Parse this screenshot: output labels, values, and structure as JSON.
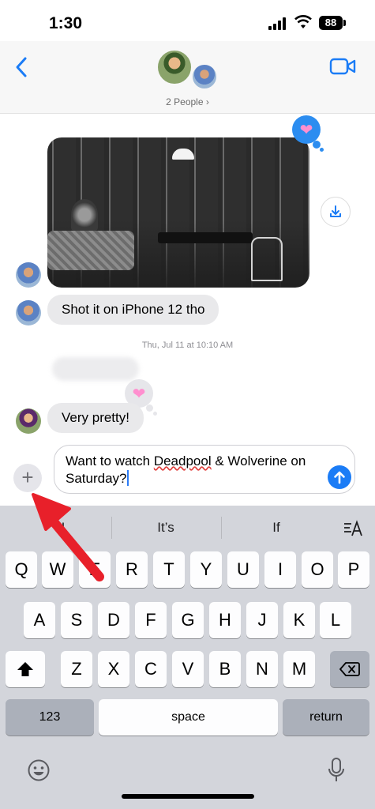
{
  "status_bar": {
    "time": "1:30",
    "battery": "88"
  },
  "header": {
    "people_label": "2 People ›"
  },
  "chat": {
    "message_1": "Shot it on iPhone 12 tho",
    "timestamp": "Thu, Jul 11 at 10:10 AM",
    "message_2": "Very pretty!"
  },
  "composer": {
    "text_part1": "Want to watch ",
    "text_typo": "Deadpool",
    "text_part2": " & Wolverine on Saturday?"
  },
  "keyboard": {
    "suggestions": [
      "I",
      "It’s",
      "If"
    ],
    "row1": [
      "Q",
      "W",
      "E",
      "R",
      "T",
      "Y",
      "U",
      "I",
      "O",
      "P"
    ],
    "row2": [
      "A",
      "S",
      "D",
      "F",
      "G",
      "H",
      "J",
      "K",
      "L"
    ],
    "row3": [
      "Z",
      "X",
      "C",
      "V",
      "B",
      "N",
      "M"
    ],
    "numbers_label": "123",
    "space_label": "space",
    "return_label": "return"
  },
  "colors": {
    "accent": "#1b7cf6",
    "annotation_arrow": "#e8202a"
  },
  "icons": [
    "back-icon",
    "video-call-icon",
    "heart-icon",
    "download-icon",
    "plus-icon",
    "send-icon",
    "shift-icon",
    "delete-icon",
    "emoji-icon",
    "microphone-icon",
    "text-format-icon"
  ]
}
